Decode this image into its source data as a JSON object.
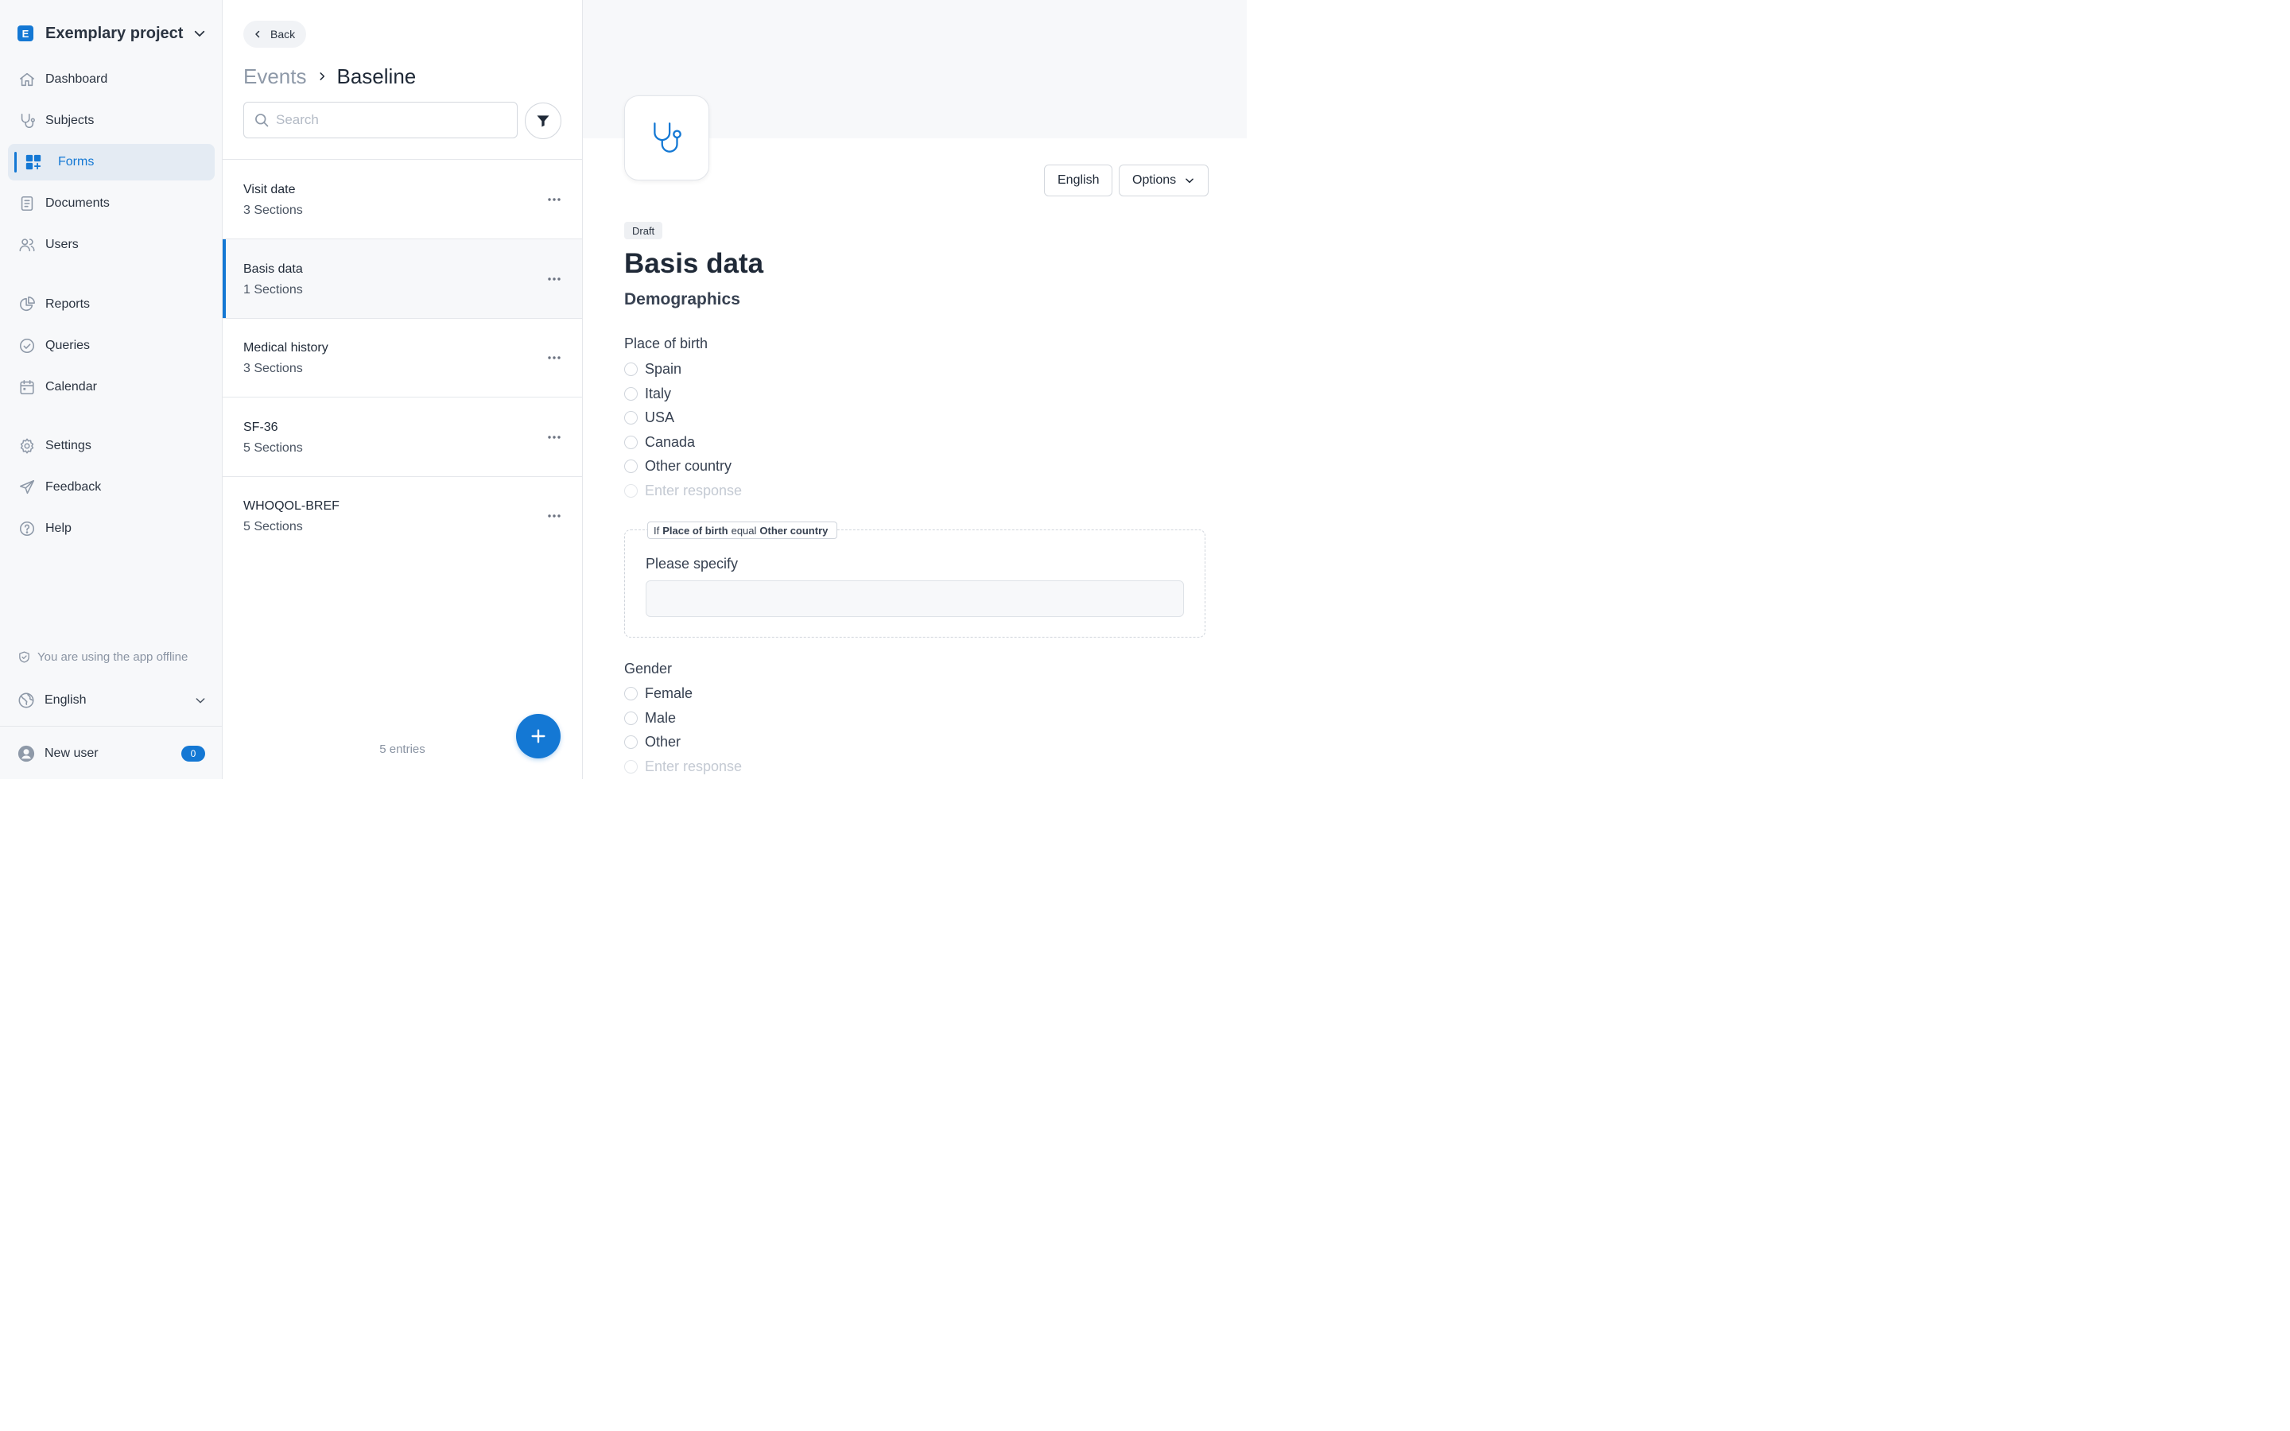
{
  "sidebar": {
    "project_initial": "E",
    "project_name": "Exemplary project",
    "nav": [
      {
        "label": "Dashboard",
        "icon": "home-icon"
      },
      {
        "label": "Subjects",
        "icon": "stethoscope-icon"
      },
      {
        "label": "Forms",
        "icon": "forms-grid-icon",
        "active": true
      },
      {
        "label": "Documents",
        "icon": "document-icon"
      },
      {
        "label": "Users",
        "icon": "users-icon"
      },
      {
        "label": "Reports",
        "icon": "pie-chart-icon"
      },
      {
        "label": "Queries",
        "icon": "check-circle-icon"
      },
      {
        "label": "Calendar",
        "icon": "calendar-icon"
      },
      {
        "label": "Settings",
        "icon": "gear-icon"
      },
      {
        "label": "Feedback",
        "icon": "paper-plane-icon"
      },
      {
        "label": "Help",
        "icon": "question-circle-icon"
      }
    ],
    "offline_text": "You are using the app offline",
    "language": "English",
    "user_name": "New user",
    "user_badge": "0"
  },
  "middle": {
    "back_label": "Back",
    "breadcrumb_parent": "Events",
    "breadcrumb_current": "Baseline",
    "search_placeholder": "Search",
    "forms": [
      {
        "title": "Visit date",
        "sections": "3 Sections"
      },
      {
        "title": "Basis data",
        "sections": "1 Sections",
        "active": true
      },
      {
        "title": "Medical history",
        "sections": "3 Sections"
      },
      {
        "title": "SF-36",
        "sections": "5 Sections"
      },
      {
        "title": "WHOQOL-BREF",
        "sections": "5 Sections"
      }
    ],
    "entries_text": "5 entries"
  },
  "detail": {
    "language_button": "English",
    "options_button": "Options",
    "status": "Draft",
    "title": "Basis data",
    "section": "Demographics",
    "q_birth": {
      "label": "Place of birth",
      "options": [
        "Spain",
        "Italy",
        "USA",
        "Canada",
        "Other country"
      ],
      "placeholder": "Enter response"
    },
    "condition": {
      "if": "If",
      "field": "Place of birth",
      "op": "equal",
      "value": "Other country",
      "label": "Please specify"
    },
    "q_gender": {
      "label": "Gender",
      "options": [
        "Female",
        "Male",
        "Other"
      ],
      "placeholder": "Enter response"
    }
  },
  "colors": {
    "accent": "#1478d4",
    "sidebar_bg": "#f7f8fa"
  }
}
